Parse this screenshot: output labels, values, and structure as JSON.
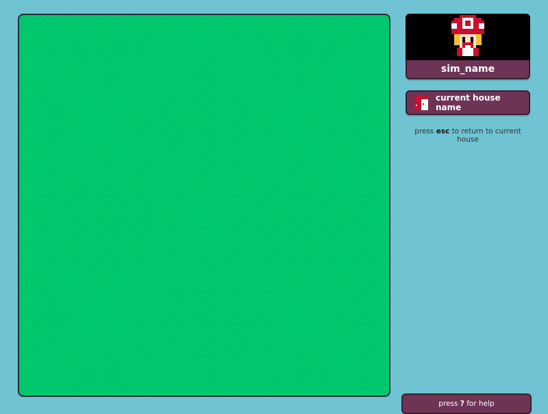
{
  "sim": {
    "name": "sim_name",
    "avatar_icon": "mushroom-character-icon"
  },
  "house_button": {
    "label": "current house name",
    "icon": "house-door-icon"
  },
  "esc_hint": {
    "prefix": "press",
    "key": "esc",
    "suffix": "to return to current house"
  },
  "help": {
    "prefix": "press",
    "key": "?",
    "suffix": "for help"
  },
  "colors": {
    "background": "#6fc3d3",
    "world": "#00c96e",
    "panel": "#6e3456",
    "panel_border": "#3a1d30"
  }
}
